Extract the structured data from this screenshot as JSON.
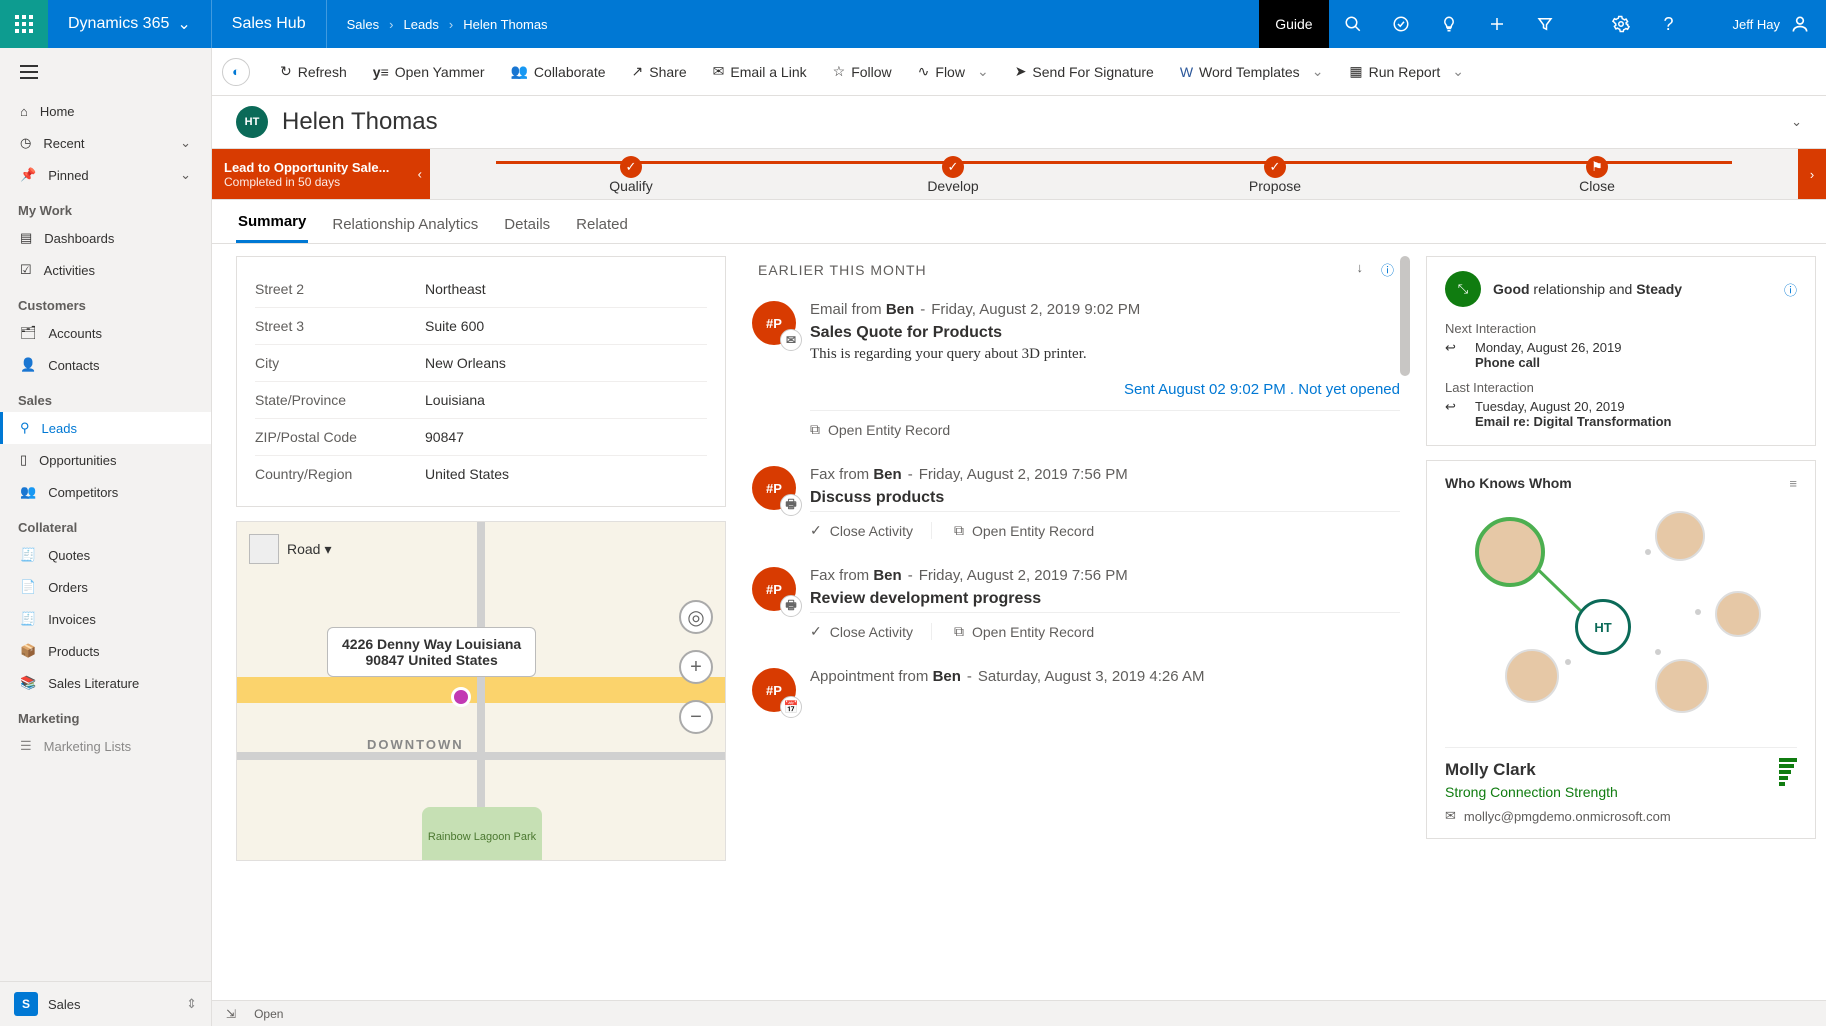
{
  "topbar": {
    "appName": "Dynamics 365",
    "hub": "Sales Hub",
    "breadcrumb": [
      "Sales",
      "Leads",
      "Helen Thomas"
    ],
    "guide": "Guide",
    "user": "Jeff Hay"
  },
  "commandbar": {
    "refresh": "Refresh",
    "yammer": "Open Yammer",
    "collaborate": "Collaborate",
    "share": "Share",
    "emailLink": "Email a Link",
    "follow": "Follow",
    "flow": "Flow",
    "sendSig": "Send For Signature",
    "wordTemplates": "Word Templates",
    "runReport": "Run Report"
  },
  "record": {
    "initials": "HT",
    "name": "Helen Thomas"
  },
  "process": {
    "name": "Lead to Opportunity Sale...",
    "sub": "Completed in 50 days",
    "stages": [
      "Qualify",
      "Develop",
      "Propose",
      "Close"
    ]
  },
  "tabs": [
    "Summary",
    "Relationship Analytics",
    "Details",
    "Related"
  ],
  "address": {
    "fields": [
      {
        "label": "Street 2",
        "value": "Northeast"
      },
      {
        "label": "Street 3",
        "value": "Suite 600"
      },
      {
        "label": "City",
        "value": "New Orleans"
      },
      {
        "label": "State/Province",
        "value": "Louisiana"
      },
      {
        "label": "ZIP/Postal Code",
        "value": "90847"
      },
      {
        "label": "Country/Region",
        "value": "United States"
      }
    ]
  },
  "map": {
    "type": "Road",
    "popupLine1": "4226 Denny Way Louisiana",
    "popupLine2": "90847 United States",
    "downtown": "DOWNTOWN",
    "park": "Rainbow Lagoon Park"
  },
  "timeline": {
    "header": "EARLIER THIS MONTH",
    "openRecord": "Open Entity Record",
    "closeActivity": "Close Activity",
    "items": [
      {
        "badge": "#P",
        "type": "Email from",
        "from": "Ben",
        "when": "Friday, August 2, 2019 9:02 PM",
        "subject": "Sales Quote for Products",
        "preview": "This is regarding your query about 3D printer.",
        "status": "Sent August 02 9:02 PM . Not yet opened",
        "actions": [
          "openRecord"
        ]
      },
      {
        "badge": "#P",
        "type": "Fax from",
        "from": "Ben",
        "when": "Friday, August 2, 2019 7:56 PM",
        "subject": "Discuss products",
        "actions": [
          "closeActivity",
          "openRecord"
        ]
      },
      {
        "badge": "#P",
        "type": "Fax from",
        "from": "Ben",
        "when": "Friday, August 2, 2019 7:56 PM",
        "subject": "Review development progress",
        "actions": [
          "closeActivity",
          "openRecord"
        ]
      },
      {
        "badge": "#P",
        "type": "Appointment from",
        "from": "Ben",
        "when": "Saturday, August 3, 2019 4:26 AM",
        "subject": ""
      }
    ]
  },
  "relationship": {
    "prefix": "Good",
    "mid": " relationship and ",
    "suffix": "Steady",
    "nextLabel": "Next Interaction",
    "nextDate": "Monday, August 26, 2019",
    "nextType": "Phone call",
    "lastLabel": "Last Interaction",
    "lastDate": "Tuesday, August 20, 2019",
    "lastType": "Email re: Digital Transformation"
  },
  "wkw": {
    "title": "Who Knows Whom",
    "centerInitials": "HT",
    "personName": "Molly Clark",
    "personStrength": "Strong Connection Strength",
    "personEmail": "mollyc@pmgdemo.onmicrosoft.com"
  },
  "sidebar": {
    "home": "Home",
    "recent": "Recent",
    "pinned": "Pinned",
    "g_mywork": "My Work",
    "dashboards": "Dashboards",
    "activities": "Activities",
    "g_customers": "Customers",
    "accounts": "Accounts",
    "contacts": "Contacts",
    "g_sales": "Sales",
    "leads": "Leads",
    "opportunities": "Opportunities",
    "competitors": "Competitors",
    "g_collateral": "Collateral",
    "quotes": "Quotes",
    "orders": "Orders",
    "invoices": "Invoices",
    "products": "Products",
    "saleslit": "Sales Literature",
    "g_marketing": "Marketing",
    "marketinglists": "Marketing Lists",
    "footerArea": "Sales",
    "footerBadge": "S"
  },
  "footer": {
    "status": "Open"
  }
}
